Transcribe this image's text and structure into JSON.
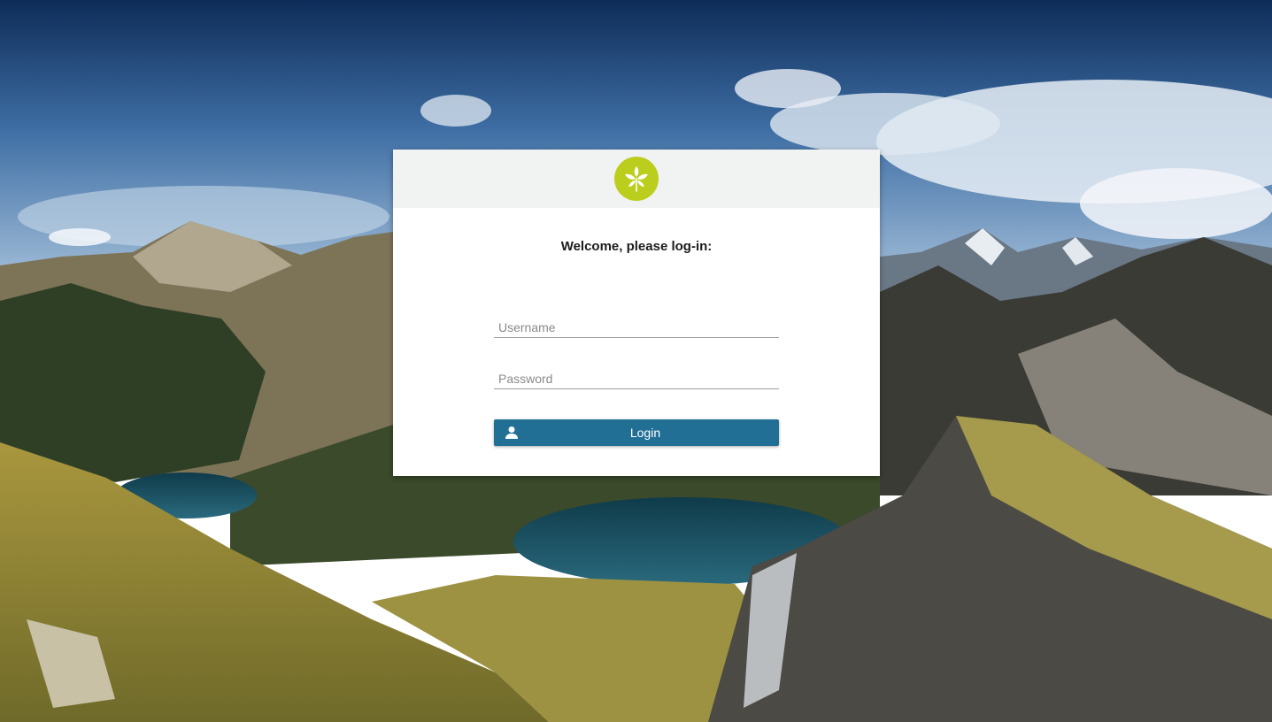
{
  "login_card": {
    "heading": "Welcome, please log-in:",
    "username": {
      "placeholder": "Username",
      "value": ""
    },
    "password": {
      "placeholder": "Password",
      "value": ""
    },
    "login_button_label": "Login",
    "login_button_icon": "user-icon",
    "logo_icon": "ivy-leaf-logo"
  },
  "colors": {
    "header_bg": "#f1f3f2",
    "logo_bg": "#bcce1d",
    "button_bg": "#226f96"
  }
}
